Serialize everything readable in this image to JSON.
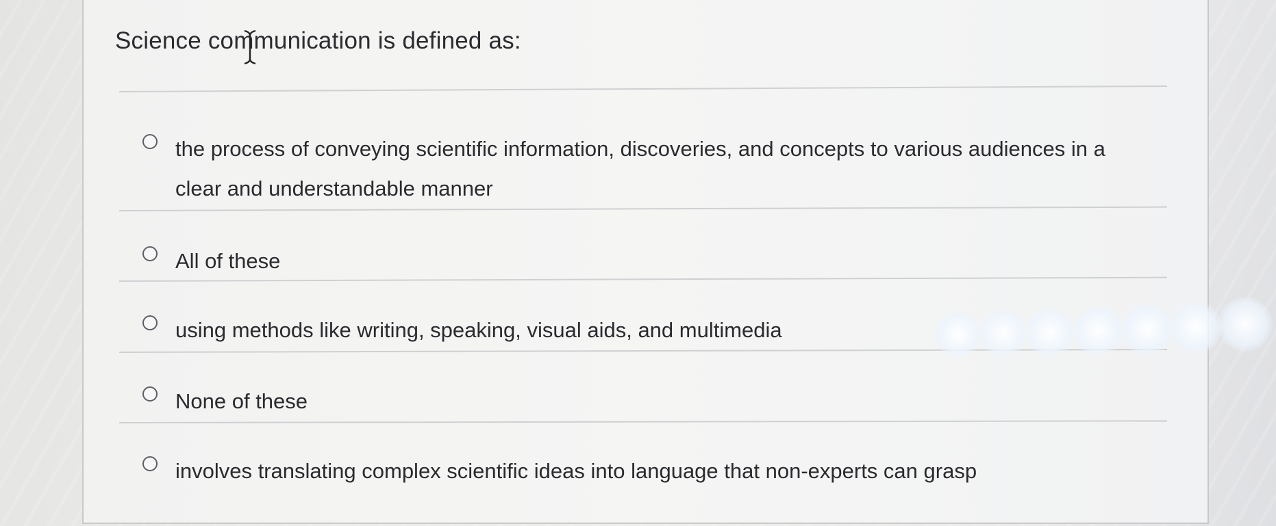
{
  "question": {
    "text": "Science communication is defined as:"
  },
  "options": [
    {
      "label": "the process of conveying scientific information, discoveries, and concepts to various audiences in a clear and understandable manner",
      "selected": false
    },
    {
      "label": "All of these",
      "selected": false
    },
    {
      "label": "using methods like writing, speaking, visual aids, and multimedia",
      "selected": false
    },
    {
      "label": "None of these",
      "selected": false
    },
    {
      "label": "involves translating complex scientific ideas into language that non-experts can grasp",
      "selected": false
    }
  ],
  "cursor": {
    "icon": "text-cursor-icon"
  },
  "colors": {
    "text": "#2a2a2f",
    "radio_border": "#5c5f66",
    "divider": "#cfd0d2",
    "background": "#f2f2f1"
  }
}
